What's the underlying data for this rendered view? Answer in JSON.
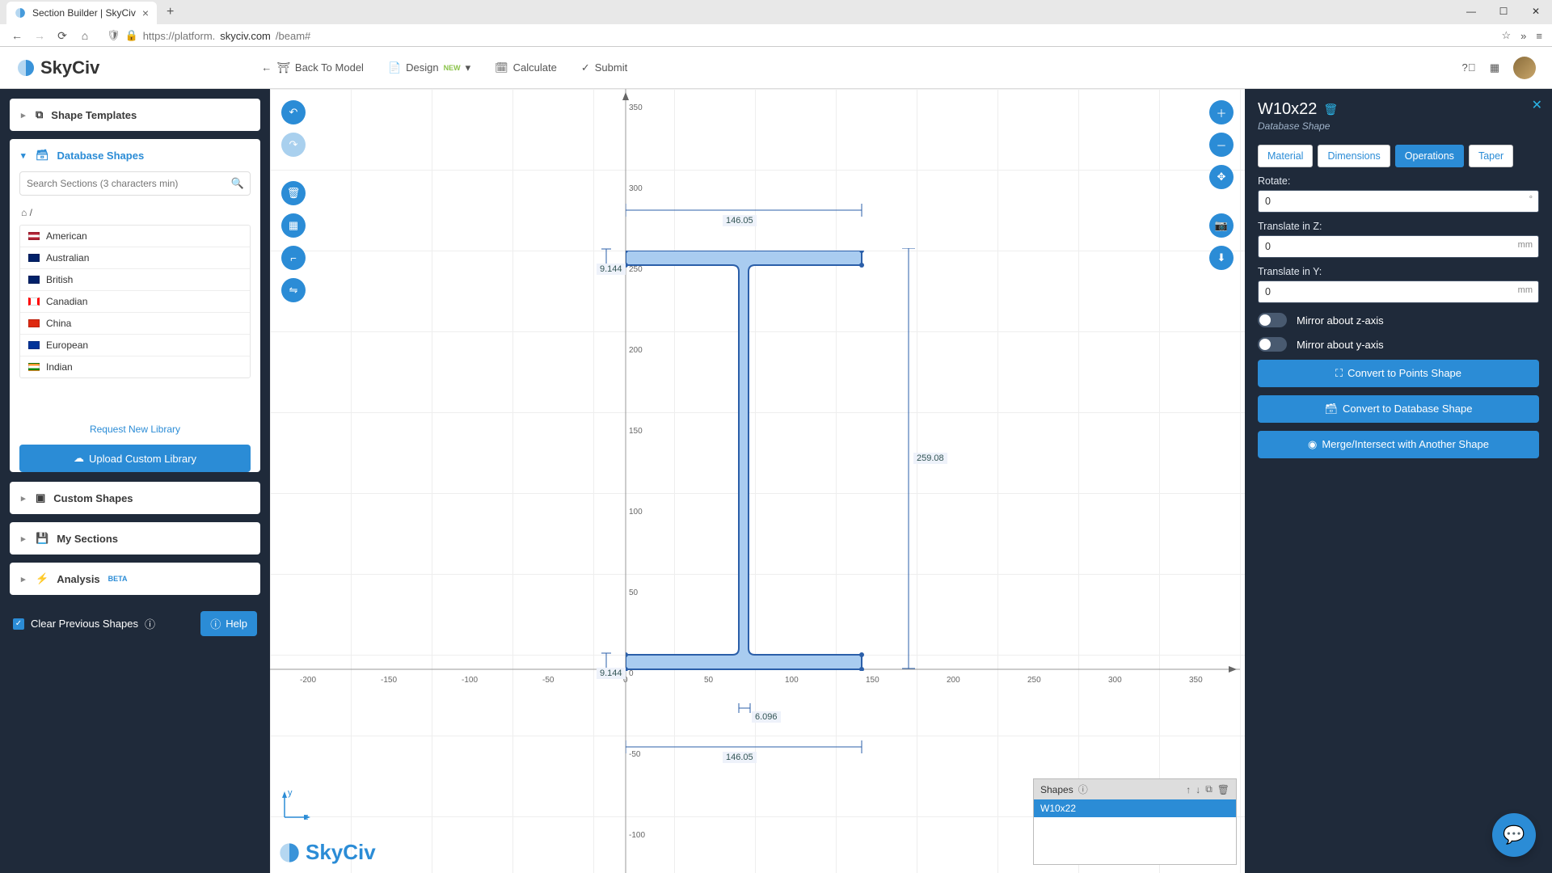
{
  "browser": {
    "tab_title": "Section Builder | SkyCiv",
    "url_prefix": "https://platform.",
    "url_domain": "skyciv.com",
    "url_path": "/beam#"
  },
  "header": {
    "brand": "SkyCiv",
    "menu": {
      "back": "Back To Model",
      "design": "Design",
      "design_badge": "NEW",
      "calculate": "Calculate",
      "submit": "Submit"
    }
  },
  "sidebar": {
    "shape_templates": "Shape Templates",
    "database_shapes": "Database Shapes",
    "search_placeholder": "Search Sections (3 characters min)",
    "regions": [
      "American",
      "Australian",
      "British",
      "Canadian",
      "China",
      "European",
      "Indian"
    ],
    "request_link": "Request New Library",
    "upload_btn": "Upload Custom Library",
    "custom_shapes": "Custom Shapes",
    "my_sections": "My Sections",
    "analysis": "Analysis",
    "analysis_badge": "BETA",
    "clear_label": "Clear Previous Shapes",
    "help": "Help"
  },
  "canvas": {
    "dim_width_top": "146.05",
    "dim_flange_top": "9.144",
    "dim_height": "259.08",
    "dim_flange_bot": "9.144",
    "dim_web": "6.096",
    "dim_width_bot": "146.05",
    "axes_y": [
      "350",
      "300",
      "250",
      "200",
      "150",
      "100",
      "50",
      "0",
      "-50",
      "-100"
    ],
    "axes_x": [
      "-200",
      "-150",
      "-100",
      "-50",
      "0",
      "50",
      "100",
      "150",
      "200",
      "250",
      "300",
      "350"
    ],
    "csys_y": "y",
    "csys_z": "z",
    "logo": "SkyCiv"
  },
  "shapes_panel": {
    "title": "Shapes",
    "row": "W10x22"
  },
  "properties": {
    "title": "W10x22",
    "subtitle": "Database Shape",
    "tabs": [
      "Material",
      "Dimensions",
      "Operations",
      "Taper"
    ],
    "active_tab": 2,
    "rotate_label": "Rotate:",
    "rotate_value": "0",
    "tz_label": "Translate in Z:",
    "tz_value": "0",
    "tz_unit": "mm",
    "ty_label": "Translate in Y:",
    "ty_value": "0",
    "ty_unit": "mm",
    "mirror_z": "Mirror about z-axis",
    "mirror_y": "Mirror about y-axis",
    "btn_points": "Convert to Points Shape",
    "btn_db": "Convert to Database Shape",
    "btn_merge": "Merge/Intersect with Another Shape"
  }
}
